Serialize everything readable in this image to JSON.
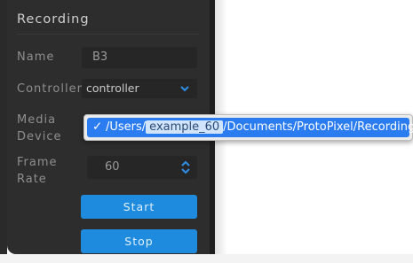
{
  "panel": {
    "title": "Recording",
    "name_label": "Name",
    "name_value": "B3",
    "controller_label": "Controller",
    "controller_value": "controller",
    "media_device_label_line1": "Media",
    "media_device_label_line2": "Device",
    "frame_rate_label_line1": "Frame",
    "frame_rate_label_line2": "Rate",
    "frame_rate_value": "60",
    "start_label": "Start",
    "stop_label": "Stop"
  },
  "popup": {
    "selected_check": "✓",
    "path_prefix": "/Users/",
    "path_user": "example_60",
    "path_suffix": "/Documents/ProtoPixel/Recordings"
  },
  "colors": {
    "panel_bg": "#2d2d2d",
    "field_bg": "#262626",
    "button_blue": "#1f8bdf",
    "selection_blue": "#2a7cf0"
  }
}
